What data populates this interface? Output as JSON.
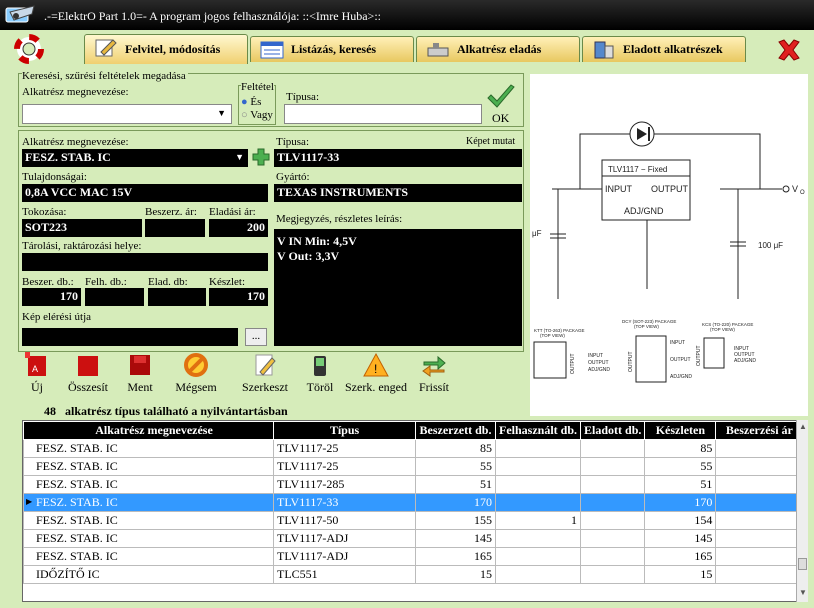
{
  "window": {
    "title": ".-=ElektrO Part 1.0=-  A program jogos felhasználója:  ::<Imre Huba>::"
  },
  "tabs": [
    {
      "label": "Felvitel, módosítás",
      "active": true
    },
    {
      "label": "Listázás, keresés"
    },
    {
      "label": "Alkatrész eladás"
    },
    {
      "label": "Eladott alkatrészek"
    }
  ],
  "search": {
    "group_title": "Keresési, szűrési feltételek megadása",
    "name_label": "Alkatrész megnevezése:",
    "name_value": "",
    "condition_title": "Feltétel",
    "cond_and": "És",
    "cond_or": "Vagy",
    "type_label": "Típusa:",
    "type_value": "",
    "ok_label": "OK"
  },
  "form": {
    "name_label": "Alkatrész megnevezése:",
    "name_value": "FESZ. STAB. IC",
    "type_label": "Típusa:",
    "type_value": "TLV1117-33",
    "show_image": "Képet mutat",
    "props_label": "Tulajdonságai:",
    "props_value": "0,8A VCC MAC 15V",
    "maker_label": "Gyártó:",
    "maker_value": "TEXAS INSTRUMENTS",
    "package_label": "Tokozása:",
    "package_value": "SOT223",
    "buy_price_label": "Beszerz. ár:",
    "buy_price_value": "",
    "sell_price_label": "Eladási ár:",
    "sell_price_value": "200",
    "note_label": "Megjegyzés, részletes leírás:",
    "note_line1": "V IN Min: 4,5V",
    "note_line2": "V Out: 3,3V",
    "storage_label": "Tárolási, raktározási helye:",
    "storage_value": "",
    "bought_label": "Beszer. db.:",
    "bought_value": "170",
    "used_label": "Felh. db.:",
    "used_value": "",
    "sold_label": "Elad. db:",
    "sold_value": "",
    "stock_label": "Készlet:",
    "stock_value": "170",
    "imgpath_label": "Kép elérési útja",
    "imgpath_value": "",
    "browse": "..."
  },
  "toolbar": {
    "new": "Új",
    "sum": "Összesít",
    "save": "Ment",
    "cancel": "Mégsem",
    "edit": "Szerkeszt",
    "delete": "Töröl",
    "allow_edit": "Szerk. enged",
    "refresh": "Frissít"
  },
  "status": {
    "count": "48",
    "text": "alkatrész típus található a nyilvántartásban"
  },
  "schematic": {
    "chip_name": "TLV1117 − Fixed",
    "input": "INPUT",
    "output": "OUTPUT",
    "adj": "ADJ/GND",
    "vo": "V",
    "vo_sub": "O",
    "cap_left": "μF",
    "cap_right": "100 μF",
    "pkg1_title": "KTT (TO-263) PACKAGE",
    "pkg1_view": "(TOP VIEW)",
    "pkg2_title": "DCY (SOT-223) PACKAGE",
    "pkg2_view": "(TOP VIEW)",
    "pkg3_title": "KCS (TO-220) PACKAGE",
    "pkg3_view": "(TOP VIEW)",
    "pin_input": "INPUT",
    "pin_output": "OUTPUT",
    "pin_adj": "ADJ/GND",
    "side_output": "OUTPUT"
  },
  "grid": {
    "columns": [
      "Alkatrész megnevezése",
      "Típus",
      "Beszerzett db.",
      "Felhasznált db.",
      "Eladott db.",
      "Készleten",
      "Beszerzési ár"
    ],
    "rows": [
      [
        "FESZ. STAB. IC",
        "TLV1117-25",
        "85",
        "",
        "",
        "85",
        ""
      ],
      [
        "FESZ. STAB. IC",
        "TLV1117-25",
        "55",
        "",
        "",
        "55",
        ""
      ],
      [
        "FESZ. STAB. IC",
        "TLV1117-285",
        "51",
        "",
        "",
        "51",
        ""
      ],
      [
        "FESZ. STAB. IC",
        "TLV1117-33",
        "170",
        "",
        "",
        "170",
        ""
      ],
      [
        "FESZ. STAB. IC",
        "TLV1117-50",
        "155",
        "1",
        "",
        "154",
        ""
      ],
      [
        "FESZ. STAB. IC",
        "TLV1117-ADJ",
        "145",
        "",
        "",
        "145",
        ""
      ],
      [
        "FESZ. STAB. IC",
        "TLV1117-ADJ",
        "165",
        "",
        "",
        "165",
        ""
      ],
      [
        "IDŐZÍTŐ IC",
        "TLC551",
        "15",
        "",
        "",
        "15",
        ""
      ]
    ],
    "selected_row": 3
  },
  "colors": {
    "bg": "#d6ecba",
    "field": "#000000",
    "selection": "#3399ff"
  }
}
